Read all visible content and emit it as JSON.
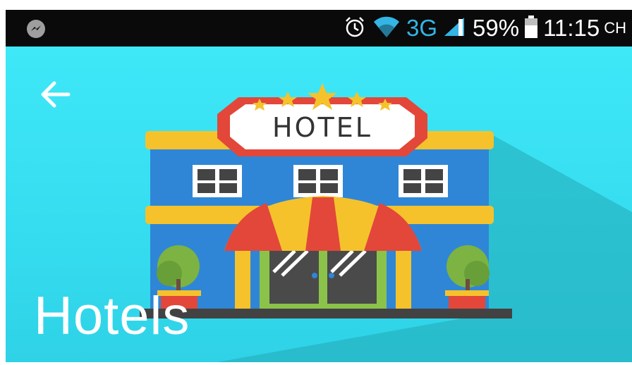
{
  "status_bar": {
    "app_icon": "messenger-icon",
    "alarm_icon": "alarm-icon",
    "wifi_icon": "wifi-icon",
    "network_type": "3G",
    "signal_icon": "signal-icon",
    "battery_percent": "59%",
    "battery_icon": "battery-icon",
    "time": "11:15",
    "time_suffix": "CH"
  },
  "toolbar": {
    "back_icon": "arrow-back-icon"
  },
  "header": {
    "title": "Hotels",
    "illustration": "hotel-building-illustration",
    "sign_text": "HOTEL"
  },
  "colors": {
    "hero_bg": "#3ee8f7",
    "shadow": "#22a9b7",
    "building_blue": "#2f86d6",
    "trim_yellow": "#f5c22c",
    "sign_red": "#e2473a",
    "status_network": "#33b5e5"
  }
}
